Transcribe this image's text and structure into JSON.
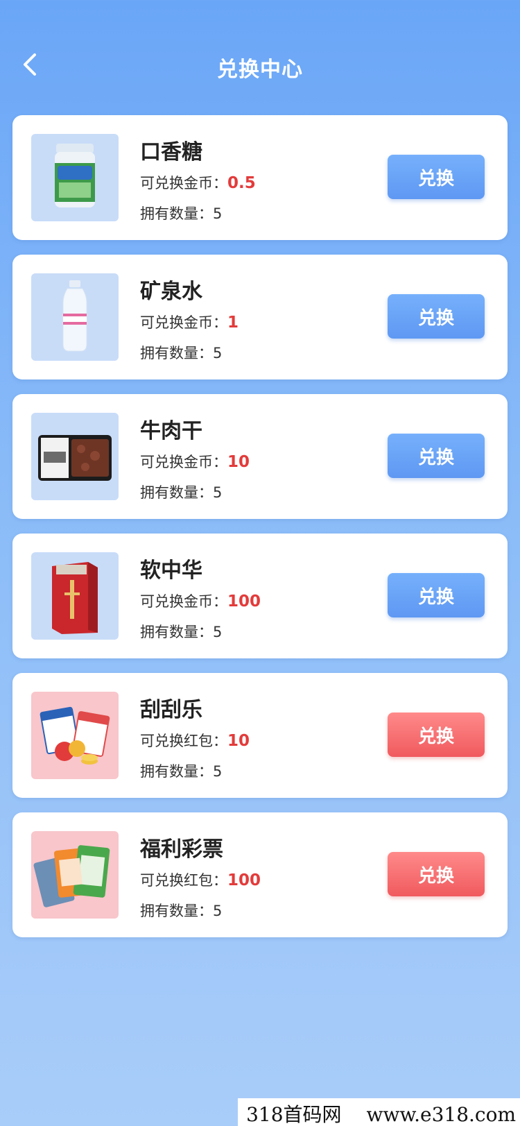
{
  "header": {
    "title": "兑换中心",
    "back_icon": "chevron-left-icon"
  },
  "items": [
    {
      "name": "口香糖",
      "price_label": "可兑换金币：",
      "price": "0.5",
      "qty_label": "拥有数量：",
      "qty": "5",
      "button": "兑换",
      "button_style": "blue",
      "image": "gum-bottle"
    },
    {
      "name": "矿泉水",
      "price_label": "可兑换金币：",
      "price": "1",
      "qty_label": "拥有数量：",
      "qty": "5",
      "button": "兑换",
      "button_style": "blue",
      "image": "water-bottle"
    },
    {
      "name": "牛肉干",
      "price_label": "可兑换金币：",
      "price": "10",
      "qty_label": "拥有数量：",
      "qty": "5",
      "button": "兑换",
      "button_style": "blue",
      "image": "beef-jerky-pack"
    },
    {
      "name": "软中华",
      "price_label": "可兑换金币：",
      "price": "100",
      "qty_label": "拥有数量：",
      "qty": "5",
      "button": "兑换",
      "button_style": "blue",
      "image": "cigarette-pack"
    },
    {
      "name": "刮刮乐",
      "price_label": "可兑换红包：",
      "price": "10",
      "qty_label": "拥有数量：",
      "qty": "5",
      "button": "兑换",
      "button_style": "red",
      "image": "bingo-cards"
    },
    {
      "name": "福利彩票",
      "price_label": "可兑换红包：",
      "price": "100",
      "qty_label": "拥有数量：",
      "qty": "5",
      "button": "兑换",
      "button_style": "red",
      "image": "lottery-tickets"
    }
  ],
  "watermark": {
    "left": "318首码网",
    "right": "www.e318.com"
  },
  "colors": {
    "accent_blue": "#5e98f3",
    "accent_red": "#f05a5e",
    "price_red": "#e33b3b"
  }
}
